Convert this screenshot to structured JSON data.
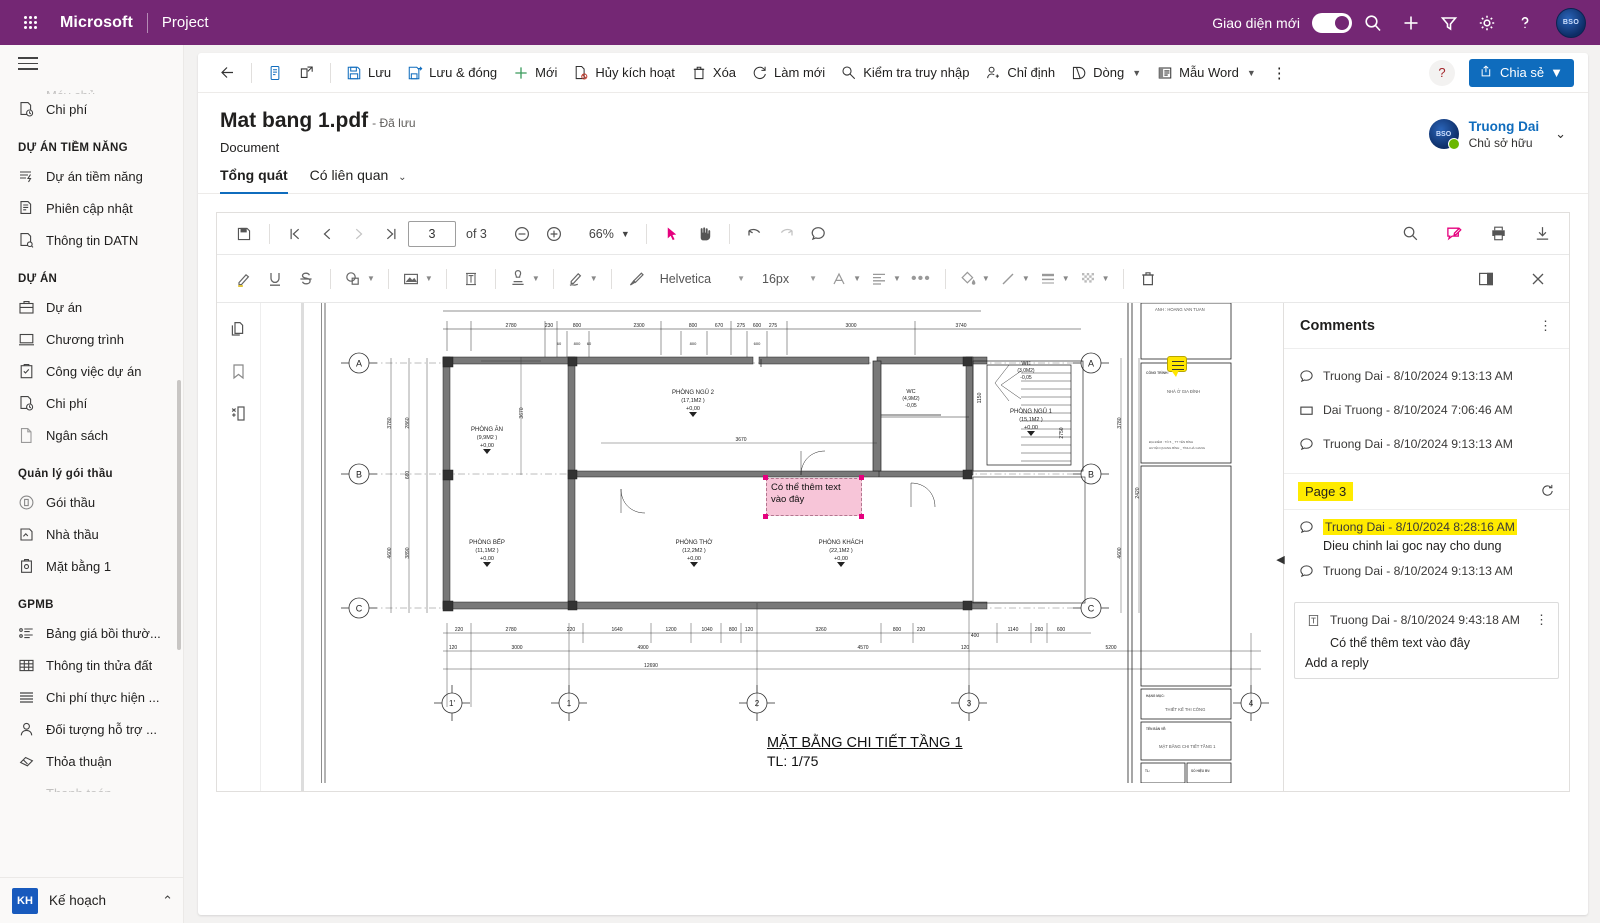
{
  "topbar": {
    "brand": "Microsoft",
    "app_name": "Project",
    "new_ui_label": "Giao diện mới",
    "avatar_initials": "BSO",
    "icons": [
      "search-icon",
      "add-icon",
      "filter-icon",
      "gear-icon",
      "help-icon"
    ]
  },
  "sidebar": {
    "groups": [
      {
        "title": "",
        "items": [
          {
            "label": "Chi phí",
            "icon": "cost-report-icon"
          }
        ]
      },
      {
        "title": "DỰ ÁN TIỀM NĂNG",
        "items": [
          {
            "label": "Dự án tiềm năng",
            "icon": "potential-project-icon"
          },
          {
            "label": "Phiên cập nhật",
            "icon": "update-session-icon"
          },
          {
            "label": "Thông tin DATN",
            "icon": "datn-info-icon"
          }
        ]
      },
      {
        "title": "DỰ ÁN",
        "items": [
          {
            "label": "Dự án",
            "icon": "briefcase-icon"
          },
          {
            "label": "Chương trình",
            "icon": "program-icon"
          },
          {
            "label": "Công việc dự án",
            "icon": "task-icon"
          },
          {
            "label": "Chi phí",
            "icon": "cost-report-icon"
          },
          {
            "label": "Ngân sách",
            "icon": "budget-icon"
          }
        ]
      },
      {
        "title": "Quản lý gói thầu",
        "items": [
          {
            "label": "Gói thầu",
            "icon": "package-icon"
          },
          {
            "label": "Nhà thầu",
            "icon": "contractor-icon"
          },
          {
            "label": "Mặt bằng 1",
            "icon": "floorplan-icon"
          }
        ]
      },
      {
        "title": "GPMB",
        "items": [
          {
            "label": "Bảng giá bồi thườ...",
            "icon": "pricelist-icon"
          },
          {
            "label": "Thông tin thửa đất",
            "icon": "landplot-icon"
          },
          {
            "label": "Chi phí thực hiện ...",
            "icon": "list-icon"
          },
          {
            "label": "Đối tượng hỗ trợ ...",
            "icon": "person-icon"
          },
          {
            "label": "Thỏa thuận",
            "icon": "handshake-icon"
          }
        ]
      }
    ],
    "footer": {
      "initials": "KH",
      "label": "Kế hoạch"
    }
  },
  "command_bar": {
    "back": "back-arrow",
    "items": [
      {
        "label": "",
        "icon": "form-icon"
      },
      {
        "label": "",
        "icon": "popout-icon"
      },
      {
        "label": "Lưu",
        "icon": "save-icon"
      },
      {
        "label": "Lưu & đóng",
        "icon": "save-close-icon"
      },
      {
        "label": "Mới",
        "icon": "plus-icon"
      },
      {
        "label": "Hủy kích hoạt",
        "icon": "deactivate-icon"
      },
      {
        "label": "Xóa",
        "icon": "trash-icon"
      },
      {
        "label": "Làm mới",
        "icon": "refresh-icon"
      },
      {
        "label": "Kiểm tra truy nhập",
        "icon": "check-access-icon"
      },
      {
        "label": "Chỉ định",
        "icon": "assign-icon"
      },
      {
        "label": "Dòng",
        "icon": "flow-icon",
        "chevron": true
      },
      {
        "label": "Mẫu Word",
        "icon": "word-template-icon",
        "chevron": true
      }
    ],
    "overflow": "⋮",
    "help": "?",
    "share": "Chia sẻ"
  },
  "document": {
    "title": "Mat bang 1.pdf",
    "saved_status": "- Đã lưu",
    "subtitle": "Document",
    "owner_name": "Truong Dai",
    "owner_role": "Chủ sở hữu",
    "owner_avatar": "BSO",
    "tabs": [
      {
        "label": "Tổng quát",
        "active": true
      },
      {
        "label": "Có liên quan",
        "active": false,
        "chevron": true
      }
    ]
  },
  "pdf_toolbar": {
    "page_value": "3",
    "page_total": "of 3",
    "zoom": "66%",
    "left_icons": [
      "save-icon",
      "first-page-icon",
      "prev-page-icon",
      "next-page-icon",
      "last-page-icon",
      "zoom-out-icon",
      "zoom-in-icon",
      "select-tool-icon",
      "pan-tool-icon",
      "undo-icon",
      "redo-icon",
      "comment-icon"
    ],
    "right_icons": [
      "search-icon",
      "annotate-icon",
      "print-icon",
      "download-icon"
    ]
  },
  "annotation_toolbar": {
    "font_family": "Helvetica",
    "font_size": "16px",
    "icons": [
      "highlight-pen-icon",
      "underline-icon",
      "strikethrough-icon",
      "shape-icon",
      "image-icon",
      "textbox-icon",
      "stamp-icon",
      "signature-icon",
      "brush-icon",
      "font-color-icon",
      "align-icon",
      "more-icon",
      "fill-color-icon",
      "stroke-icon",
      "line-weight-icon",
      "opacity-icon",
      "delete-icon",
      "panel-toggle-icon",
      "close-icon"
    ]
  },
  "viewer_rail": [
    "pages-icon",
    "bookmark-icon",
    "layers-icon"
  ],
  "comments": {
    "header": "Comments",
    "kebab": "⋮",
    "top_items": [
      {
        "icon": "comment-icon",
        "meta": "Truong Dai - 8/10/2024 9:13:13 AM"
      },
      {
        "icon": "rect-annotation-icon",
        "meta": "Dai Truong - 8/10/2024 7:06:46 AM"
      },
      {
        "icon": "comment-icon",
        "meta": "Truong Dai - 8/10/2024 9:13:13 AM"
      }
    ],
    "page_group_label": "Page 3",
    "page_items": [
      {
        "icon": "comment-icon",
        "meta": "Truong Dai - 8/10/2024 8:28:16 AM",
        "highlighted": true,
        "body": "Dieu chinh lai goc nay cho dung"
      },
      {
        "icon": "comment-icon",
        "meta": "Truong Dai - 8/10/2024 9:13:13 AM",
        "highlighted": false,
        "body": ""
      }
    ],
    "card": {
      "icon": "textbox-annotation-icon",
      "meta": "Truong Dai - 8/10/2024 9:43:18 AM",
      "kebab": "⋮",
      "body": "Có thể thêm text vào đây",
      "reply_placeholder": "Add a reply"
    }
  },
  "floorplan": {
    "annotation_text": "Có thể thêm text vào đây",
    "title": "MẶT BẰNG CHI TIẾT TẦNG 1",
    "scale": "TL: 1/75",
    "rooms": [
      {
        "name": "PHÒNG ĂN",
        "area": "(9,9M2 )",
        "level": "+0,00"
      },
      {
        "name": "PHÒNG NGỦ 2",
        "area": "(17,1M2 )",
        "level": "+0,00"
      },
      {
        "name": "PHÒNG BẾP",
        "area": "(11,1M2 )",
        "level": "+0,00"
      },
      {
        "name": "PHÒNG THỜ",
        "area": "(12,2M2 )",
        "level": "+0,00"
      },
      {
        "name": "PHÒNG KHÁCH",
        "area": "(22,1M2 )",
        "level": "+0,00"
      },
      {
        "name": "PHÒNG NGỦ 1",
        "area": "(15,1M2 )",
        "level": "+0,00"
      },
      {
        "name": "WC",
        "area": "(4,9M2)",
        "level": "-0,05"
      },
      {
        "name": "WC",
        "area": "(3,0M2)",
        "level": "-0,05"
      }
    ],
    "grid_letters": [
      "A",
      "B",
      "C"
    ],
    "grid_numbers": [
      "1'",
      "1",
      "2",
      "3",
      "4"
    ],
    "titleblock": {
      "owner": "ANH : HOANG VAN TUAN",
      "project_label": "CÔNG TRÌNH:",
      "project_name": "NHÀ Ở GIA ĐÌNH",
      "location": "ĐỊA ĐIỂM : TỔ 5 _ TT YÊN BÌNH HUYỆN QUANG BÌNH _ TỈNH HÀ GIANG",
      "section_label": "HẠNG MỤC:",
      "section_value": "THIẾT KẾ THI CÔNG",
      "drawing_label": "TÊN BẢN VẼ:",
      "drawing_value": "MẶT BẰNG CHI TIẾT TẦNG 1",
      "scale_label": "TL:",
      "sheet_label": "SỐ HIỆU BV:"
    },
    "dim_row_top": [
      "2780",
      "230",
      "800",
      "2300",
      "800",
      "670",
      "275",
      "600",
      "275",
      "3000",
      "3740"
    ],
    "dim_row_mid": [
      "2780",
      "230",
      "1640",
      "1200",
      "1040",
      "800",
      "120",
      "3260",
      "800",
      "220",
      "1140",
      "260",
      "600"
    ],
    "dim_row_low": [
      "120",
      "3000",
      "4900",
      "4570",
      "120",
      "5200"
    ],
    "dim_total": "12690",
    "left_dims": [
      "3780",
      "2860",
      "4600",
      "3890",
      "2290",
      "1380",
      "660"
    ]
  }
}
